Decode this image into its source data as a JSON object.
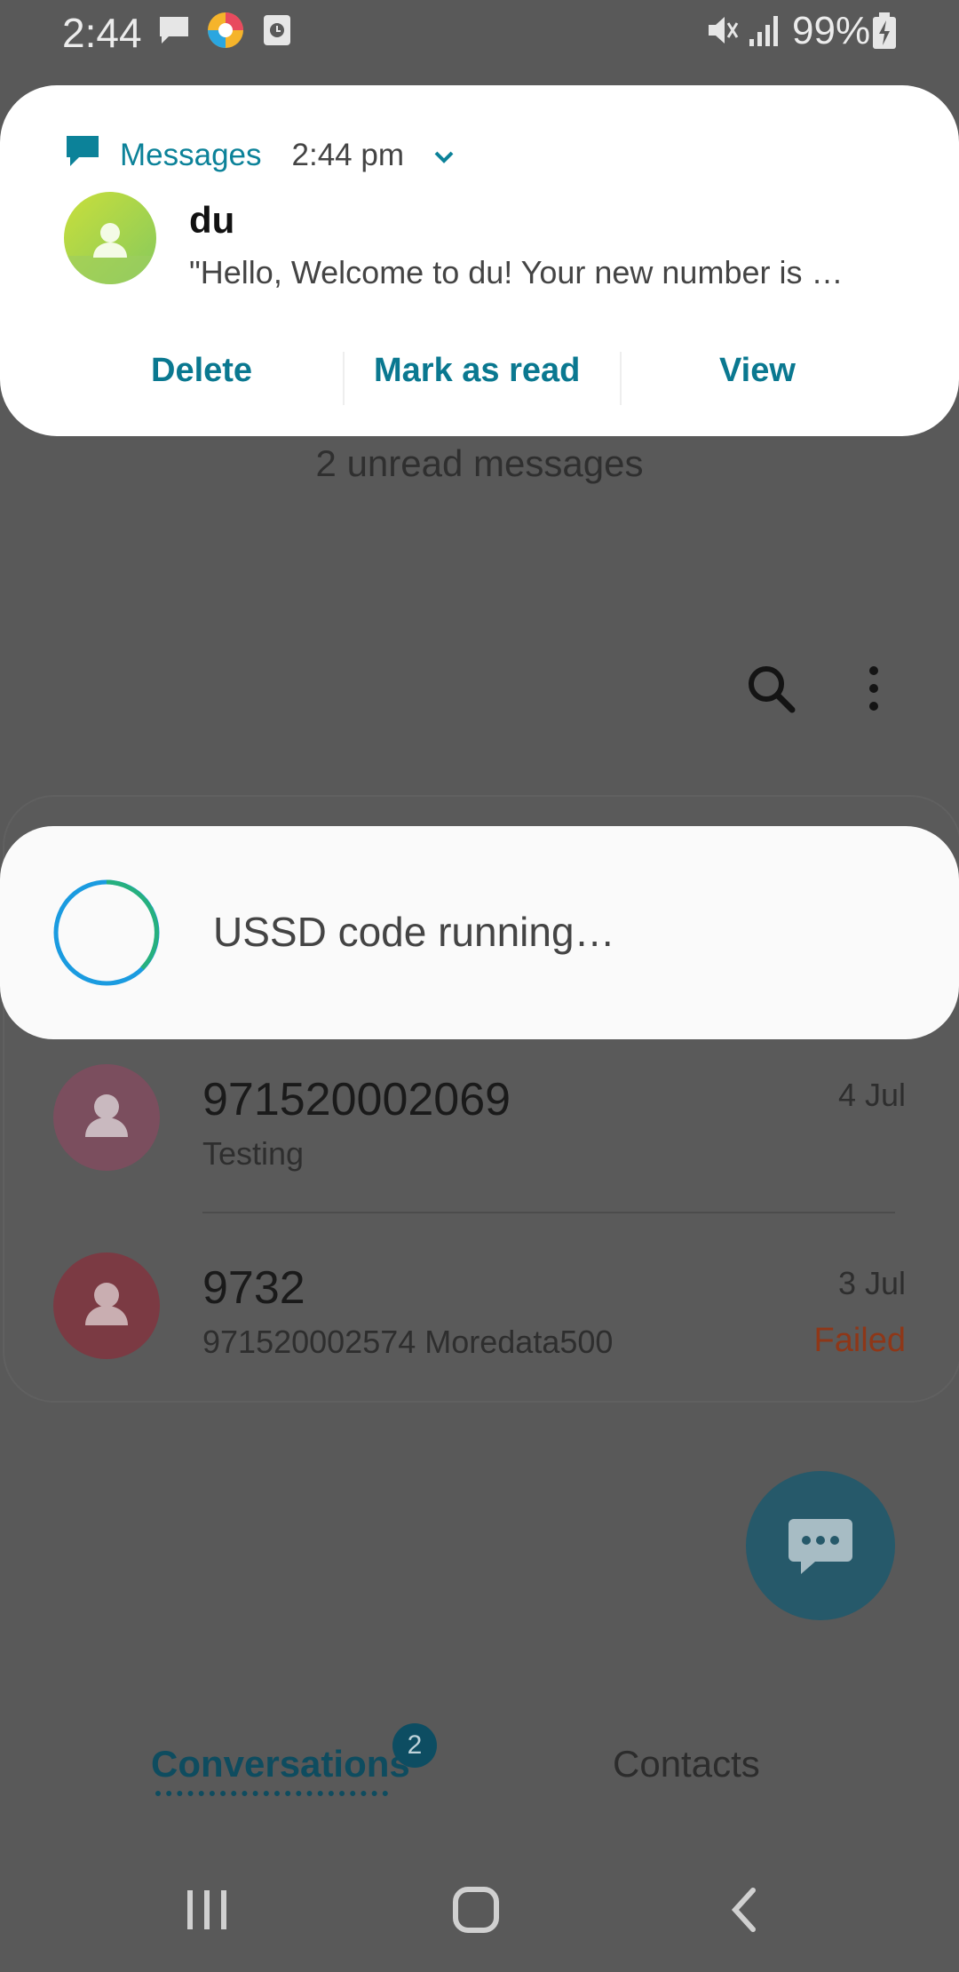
{
  "status_bar": {
    "time": "2:44",
    "battery": "99%",
    "icons": [
      "chat-icon",
      "browser-icon",
      "clock-app-icon",
      "mute-icon",
      "signal-icon",
      "battery-charging-icon"
    ]
  },
  "notification": {
    "app_name": "Messages",
    "time": "2:44 pm",
    "sender": "du",
    "preview": "\"Hello, Welcome to du! Your new number is …",
    "actions": {
      "delete": "Delete",
      "mark_read": "Mark as read",
      "view": "View"
    },
    "accent_color": "#0c8299"
  },
  "app": {
    "unread_label": "2 unread messages"
  },
  "conversations": [
    {
      "name": "971520002069",
      "preview": "Testing",
      "date": "4 Jul",
      "status": "",
      "avatar_color": "#7b4e5e"
    },
    {
      "name": "9732",
      "preview": "971520002574 Moredata500",
      "date": "3 Jul",
      "status": "Failed",
      "avatar_color": "#7b3a43"
    }
  ],
  "ussd_dialog": {
    "text": "USSD code running…"
  },
  "tabs": {
    "conversations": "Conversations",
    "badge": "2",
    "contacts": "Contacts"
  },
  "colors": {
    "failed": "#8e3718",
    "fab": "#26596a"
  }
}
